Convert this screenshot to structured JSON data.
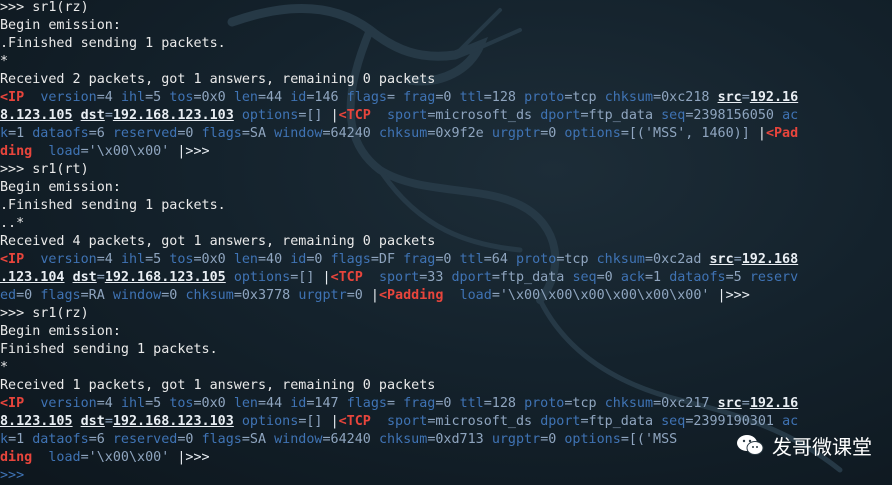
{
  "terminal": {
    "lines": [
      [
        {
          "c": "prompt",
          "t": ">>> sr1(rz)"
        }
      ],
      [
        {
          "c": "w",
          "t": "Begin emission:"
        }
      ],
      [
        {
          "c": "w",
          "t": ".Finished sending 1 packets."
        }
      ],
      [
        {
          "c": "w",
          "t": "*"
        }
      ],
      [
        {
          "c": "w",
          "t": "Received 2 packets, got 1 answers, remaining 0 packets"
        }
      ],
      [
        {
          "c": "t",
          "t": "<IP"
        },
        {
          "c": "v",
          "t": "  "
        },
        {
          "c": "k",
          "t": "version"
        },
        {
          "c": "v",
          "t": "=4 "
        },
        {
          "c": "k",
          "t": "ihl"
        },
        {
          "c": "v",
          "t": "=5 "
        },
        {
          "c": "k",
          "t": "tos"
        },
        {
          "c": "v",
          "t": "=0x0 "
        },
        {
          "c": "k",
          "t": "len"
        },
        {
          "c": "v",
          "t": "=44 "
        },
        {
          "c": "k",
          "t": "id"
        },
        {
          "c": "v",
          "t": "=146 "
        },
        {
          "c": "k",
          "t": "flags"
        },
        {
          "c": "v",
          "t": "= "
        },
        {
          "c": "k",
          "t": "frag"
        },
        {
          "c": "v",
          "t": "=0 "
        },
        {
          "c": "k",
          "t": "ttl"
        },
        {
          "c": "v",
          "t": "=128 "
        },
        {
          "c": "k",
          "t": "proto"
        },
        {
          "c": "v",
          "t": "=tcp "
        },
        {
          "c": "k",
          "t": "chksum"
        },
        {
          "c": "v",
          "t": "=0xc218 "
        },
        {
          "c": "ip",
          "t": "src"
        },
        {
          "c": "v",
          "t": "="
        },
        {
          "c": "ip",
          "t": "192.16"
        }
      ],
      [
        {
          "c": "ip",
          "t": "8.123.105"
        },
        {
          "c": "v",
          "t": " "
        },
        {
          "c": "ip",
          "t": "dst"
        },
        {
          "c": "v",
          "t": "="
        },
        {
          "c": "ip",
          "t": "192.168.123.103"
        },
        {
          "c": "v",
          "t": " "
        },
        {
          "c": "k",
          "t": "options"
        },
        {
          "c": "v",
          "t": "=[] "
        },
        {
          "c": "p",
          "t": "|"
        },
        {
          "c": "t",
          "t": "<TCP"
        },
        {
          "c": "v",
          "t": "  "
        },
        {
          "c": "k",
          "t": "sport"
        },
        {
          "c": "v",
          "t": "=microsoft_ds "
        },
        {
          "c": "k",
          "t": "dport"
        },
        {
          "c": "v",
          "t": "=ftp_data "
        },
        {
          "c": "k",
          "t": "seq"
        },
        {
          "c": "v",
          "t": "=2398156050 "
        },
        {
          "c": "k",
          "t": "ac"
        }
      ],
      [
        {
          "c": "k",
          "t": "k"
        },
        {
          "c": "v",
          "t": "=1 "
        },
        {
          "c": "k",
          "t": "dataofs"
        },
        {
          "c": "v",
          "t": "=6 "
        },
        {
          "c": "k",
          "t": "reserved"
        },
        {
          "c": "v",
          "t": "=0 "
        },
        {
          "c": "k",
          "t": "flags"
        },
        {
          "c": "v",
          "t": "=SA "
        },
        {
          "c": "k",
          "t": "window"
        },
        {
          "c": "v",
          "t": "=64240 "
        },
        {
          "c": "k",
          "t": "chksum"
        },
        {
          "c": "v",
          "t": "=0x9f2e "
        },
        {
          "c": "k",
          "t": "urgptr"
        },
        {
          "c": "v",
          "t": "=0 "
        },
        {
          "c": "k",
          "t": "options"
        },
        {
          "c": "v",
          "t": "=[('MSS', 1460)] "
        },
        {
          "c": "p",
          "t": "|"
        },
        {
          "c": "t",
          "t": "<Pad"
        }
      ],
      [
        {
          "c": "t",
          "t": "ding"
        },
        {
          "c": "v",
          "t": "  "
        },
        {
          "c": "k",
          "t": "load"
        },
        {
          "c": "v",
          "t": "='\\x00\\x00' "
        },
        {
          "c": "p",
          "t": "|>>>"
        }
      ],
      [
        {
          "c": "prompt",
          "t": ">>> sr1(rt)"
        }
      ],
      [
        {
          "c": "w",
          "t": "Begin emission:"
        }
      ],
      [
        {
          "c": "w",
          "t": ".Finished sending 1 packets."
        }
      ],
      [
        {
          "c": "w",
          "t": "..*"
        }
      ],
      [
        {
          "c": "w",
          "t": "Received 4 packets, got 1 answers, remaining 0 packets"
        }
      ],
      [
        {
          "c": "t",
          "t": "<IP"
        },
        {
          "c": "v",
          "t": "  "
        },
        {
          "c": "k",
          "t": "version"
        },
        {
          "c": "v",
          "t": "=4 "
        },
        {
          "c": "k",
          "t": "ihl"
        },
        {
          "c": "v",
          "t": "=5 "
        },
        {
          "c": "k",
          "t": "tos"
        },
        {
          "c": "v",
          "t": "=0x0 "
        },
        {
          "c": "k",
          "t": "len"
        },
        {
          "c": "v",
          "t": "=40 "
        },
        {
          "c": "k",
          "t": "id"
        },
        {
          "c": "v",
          "t": "=0 "
        },
        {
          "c": "k",
          "t": "flags"
        },
        {
          "c": "v",
          "t": "=DF "
        },
        {
          "c": "k",
          "t": "frag"
        },
        {
          "c": "v",
          "t": "=0 "
        },
        {
          "c": "k",
          "t": "ttl"
        },
        {
          "c": "v",
          "t": "=64 "
        },
        {
          "c": "k",
          "t": "proto"
        },
        {
          "c": "v",
          "t": "=tcp "
        },
        {
          "c": "k",
          "t": "chksum"
        },
        {
          "c": "v",
          "t": "=0xc2ad "
        },
        {
          "c": "ip",
          "t": "src"
        },
        {
          "c": "v",
          "t": "="
        },
        {
          "c": "ip",
          "t": "192.168"
        }
      ],
      [
        {
          "c": "ip",
          "t": ".123.104"
        },
        {
          "c": "v",
          "t": " "
        },
        {
          "c": "ip",
          "t": "dst"
        },
        {
          "c": "v",
          "t": "="
        },
        {
          "c": "ip",
          "t": "192.168.123.105"
        },
        {
          "c": "v",
          "t": " "
        },
        {
          "c": "k",
          "t": "options"
        },
        {
          "c": "v",
          "t": "=[] "
        },
        {
          "c": "p",
          "t": "|"
        },
        {
          "c": "t",
          "t": "<TCP"
        },
        {
          "c": "v",
          "t": "  "
        },
        {
          "c": "k",
          "t": "sport"
        },
        {
          "c": "v",
          "t": "=33 "
        },
        {
          "c": "k",
          "t": "dport"
        },
        {
          "c": "v",
          "t": "=ftp_data "
        },
        {
          "c": "k",
          "t": "seq"
        },
        {
          "c": "v",
          "t": "=0 "
        },
        {
          "c": "k",
          "t": "ack"
        },
        {
          "c": "v",
          "t": "=1 "
        },
        {
          "c": "k",
          "t": "dataofs"
        },
        {
          "c": "v",
          "t": "=5 "
        },
        {
          "c": "k",
          "t": "reserv"
        }
      ],
      [
        {
          "c": "k",
          "t": "ed"
        },
        {
          "c": "v",
          "t": "=0 "
        },
        {
          "c": "k",
          "t": "flags"
        },
        {
          "c": "v",
          "t": "=RA "
        },
        {
          "c": "k",
          "t": "window"
        },
        {
          "c": "v",
          "t": "=0 "
        },
        {
          "c": "k",
          "t": "chksum"
        },
        {
          "c": "v",
          "t": "=0x3778 "
        },
        {
          "c": "k",
          "t": "urgptr"
        },
        {
          "c": "v",
          "t": "=0 "
        },
        {
          "c": "p",
          "t": "|"
        },
        {
          "c": "t",
          "t": "<Padding"
        },
        {
          "c": "v",
          "t": "  "
        },
        {
          "c": "k",
          "t": "load"
        },
        {
          "c": "v",
          "t": "='\\x00\\x00\\x00\\x00\\x00\\x00' "
        },
        {
          "c": "p",
          "t": "|>>>"
        }
      ],
      [
        {
          "c": "prompt",
          "t": ">>> sr1(rz)"
        }
      ],
      [
        {
          "c": "w",
          "t": "Begin emission:"
        }
      ],
      [
        {
          "c": "w",
          "t": "Finished sending 1 packets."
        }
      ],
      [
        {
          "c": "w",
          "t": "*"
        }
      ],
      [
        {
          "c": "w",
          "t": "Received 1 packets, got 1 answers, remaining 0 packets"
        }
      ],
      [
        {
          "c": "t",
          "t": "<IP"
        },
        {
          "c": "v",
          "t": "  "
        },
        {
          "c": "k",
          "t": "version"
        },
        {
          "c": "v",
          "t": "=4 "
        },
        {
          "c": "k",
          "t": "ihl"
        },
        {
          "c": "v",
          "t": "=5 "
        },
        {
          "c": "k",
          "t": "tos"
        },
        {
          "c": "v",
          "t": "=0x0 "
        },
        {
          "c": "k",
          "t": "len"
        },
        {
          "c": "v",
          "t": "=44 "
        },
        {
          "c": "k",
          "t": "id"
        },
        {
          "c": "v",
          "t": "=147 "
        },
        {
          "c": "k",
          "t": "flags"
        },
        {
          "c": "v",
          "t": "= "
        },
        {
          "c": "k",
          "t": "frag"
        },
        {
          "c": "v",
          "t": "=0 "
        },
        {
          "c": "k",
          "t": "ttl"
        },
        {
          "c": "v",
          "t": "=128 "
        },
        {
          "c": "k",
          "t": "proto"
        },
        {
          "c": "v",
          "t": "=tcp "
        },
        {
          "c": "k",
          "t": "chksum"
        },
        {
          "c": "v",
          "t": "=0xc217 "
        },
        {
          "c": "ip",
          "t": "src"
        },
        {
          "c": "v",
          "t": "="
        },
        {
          "c": "ip",
          "t": "192.16"
        }
      ],
      [
        {
          "c": "ip",
          "t": "8.123.105"
        },
        {
          "c": "v",
          "t": " "
        },
        {
          "c": "ip",
          "t": "dst"
        },
        {
          "c": "v",
          "t": "="
        },
        {
          "c": "ip",
          "t": "192.168.123.103"
        },
        {
          "c": "v",
          "t": " "
        },
        {
          "c": "k",
          "t": "options"
        },
        {
          "c": "v",
          "t": "=[] "
        },
        {
          "c": "p",
          "t": "|"
        },
        {
          "c": "t",
          "t": "<TCP"
        },
        {
          "c": "v",
          "t": "  "
        },
        {
          "c": "k",
          "t": "sport"
        },
        {
          "c": "v",
          "t": "=microsoft_ds "
        },
        {
          "c": "k",
          "t": "dport"
        },
        {
          "c": "v",
          "t": "=ftp_data "
        },
        {
          "c": "k",
          "t": "seq"
        },
        {
          "c": "v",
          "t": "=2399190301 "
        },
        {
          "c": "k",
          "t": "ac"
        }
      ],
      [
        {
          "c": "k",
          "t": "k"
        },
        {
          "c": "v",
          "t": "=1 "
        },
        {
          "c": "k",
          "t": "dataofs"
        },
        {
          "c": "v",
          "t": "=6 "
        },
        {
          "c": "k",
          "t": "reserved"
        },
        {
          "c": "v",
          "t": "=0 "
        },
        {
          "c": "k",
          "t": "flags"
        },
        {
          "c": "v",
          "t": "=SA "
        },
        {
          "c": "k",
          "t": "window"
        },
        {
          "c": "v",
          "t": "=64240 "
        },
        {
          "c": "k",
          "t": "chksum"
        },
        {
          "c": "v",
          "t": "=0xd713 "
        },
        {
          "c": "k",
          "t": "urgptr"
        },
        {
          "c": "v",
          "t": "=0 "
        },
        {
          "c": "k",
          "t": "options"
        },
        {
          "c": "v",
          "t": "=[('MSS"
        }
      ],
      [
        {
          "c": "t",
          "t": "ding"
        },
        {
          "c": "v",
          "t": "  "
        },
        {
          "c": "k",
          "t": "load"
        },
        {
          "c": "v",
          "t": "='\\x00\\x00' "
        },
        {
          "c": "p",
          "t": "|>>>"
        }
      ],
      [
        {
          "c": "prompt-blue",
          "t": ">>>"
        }
      ]
    ]
  },
  "watermark": {
    "icon": "wechat-icon",
    "text": "发哥微课堂"
  },
  "colors": {
    "background": "#14222c",
    "plain_text": "#eaeaea",
    "field_name": "#3f73b4",
    "field_value": "#8fa5bf",
    "layer_name": "#e8453c",
    "address": "#e9eef3"
  }
}
